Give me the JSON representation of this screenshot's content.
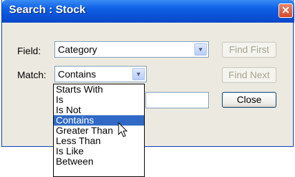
{
  "window": {
    "title": "Search : Stock",
    "close_glyph": "✕"
  },
  "field": {
    "label": "Field:",
    "value": "Category"
  },
  "match": {
    "label": "Match:",
    "value": "Contains",
    "options": [
      "Starts With",
      "Is",
      "Is Not",
      "Contains",
      "Greater Than",
      "Less Than",
      "Is Like",
      "Between"
    ],
    "selected_index": 3
  },
  "buttons": {
    "find_first": "Find First",
    "find_next": "Find Next",
    "close": "Close"
  },
  "icons": {
    "dropdown_arrow": "chevron-down-icon",
    "pointer": "mouse-pointer-icon"
  },
  "colors": {
    "title_bar": "#0a52d8",
    "selection": "#316ac5",
    "close_button": "#d84a26"
  }
}
